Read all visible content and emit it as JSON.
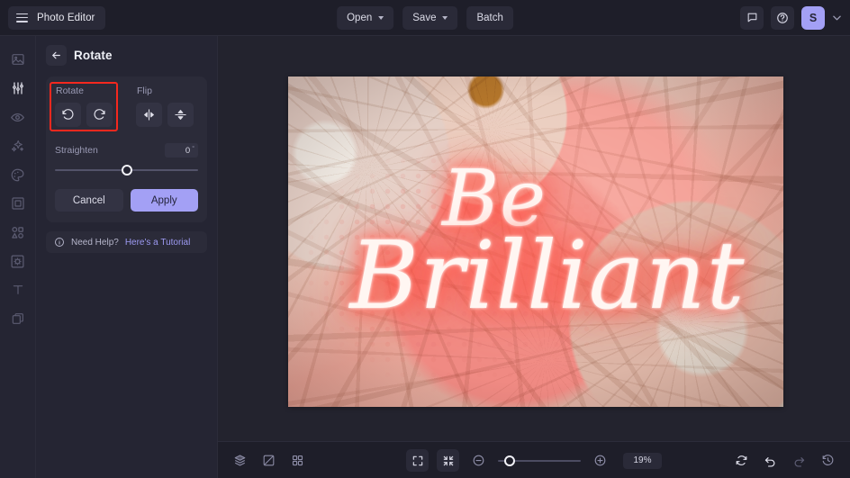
{
  "topbar": {
    "brand": "Photo Editor",
    "menu_icon": "hamburger-icon",
    "buttons": [
      {
        "label": "Open",
        "caret": true
      },
      {
        "label": "Save",
        "caret": true
      },
      {
        "label": "Batch",
        "caret": false
      }
    ],
    "feedback_icon": "chat-bubble-icon",
    "help_icon": "question-circle-icon",
    "avatar_initial": "S",
    "avatar_color": "#a3a0f5"
  },
  "rail": {
    "items": [
      {
        "name": "image",
        "icon": "image-icon",
        "active": false
      },
      {
        "name": "adjust",
        "icon": "sliders-icon",
        "active": true
      },
      {
        "name": "eye",
        "icon": "eye-icon",
        "active": false
      },
      {
        "name": "effects",
        "icon": "sparkles-icon",
        "active": false
      },
      {
        "name": "retouch",
        "icon": "palette-icon",
        "active": false
      },
      {
        "name": "frames",
        "icon": "frame-icon",
        "active": false
      },
      {
        "name": "shapes",
        "icon": "shapes-icon",
        "active": false
      },
      {
        "name": "overlay",
        "icon": "texture-icon",
        "active": false
      },
      {
        "name": "text",
        "icon": "text-t-icon",
        "active": false
      },
      {
        "name": "layers",
        "icon": "layers-stack-icon",
        "active": false
      }
    ]
  },
  "panel": {
    "back_icon": "arrow-left-icon",
    "title": "Rotate",
    "rotate_group_label": "Rotate",
    "flip_group_label": "Flip",
    "rotate_left_icon": "rotate-counterclockwise-icon",
    "rotate_right_icon": "rotate-clockwise-icon",
    "flip_horizontal_icon": "flip-horizontal-icon",
    "flip_vertical_icon": "flip-vertical-icon",
    "highlight_color": "#f5281e",
    "straighten_label": "Straighten",
    "straighten_value": "0",
    "straighten_unit": "°",
    "straighten_slider_percent": 50,
    "cancel_label": "Cancel",
    "apply_label": "Apply",
    "help_icon": "info-circle-icon",
    "help_text": "Need Help?",
    "help_link": "Here's a Tutorial"
  },
  "canvas": {
    "photo_alt": "Neon sign reading Be Brilliant over a pink floral background",
    "neon_line_1": "Be",
    "neon_line_2": "Brilliant"
  },
  "bottombar": {
    "left": [
      {
        "name": "layers",
        "icon": "layers-icon"
      },
      {
        "name": "compare",
        "icon": "compare-icon"
      },
      {
        "name": "grid",
        "icon": "grid-icon"
      }
    ],
    "center": {
      "fit_icon": "fit-screen-icon",
      "actual_icon": "shrink-icon",
      "zoom_out_icon": "minus-circle-icon",
      "zoom_in_icon": "plus-circle-icon",
      "zoom_value": "19%",
      "zoom_slider_percent": 9
    },
    "right": [
      {
        "name": "reset",
        "icon": "reset-icon"
      },
      {
        "name": "undo",
        "icon": "undo-icon"
      },
      {
        "name": "redo",
        "icon": "redo-icon"
      },
      {
        "name": "history",
        "icon": "history-icon"
      }
    ]
  }
}
